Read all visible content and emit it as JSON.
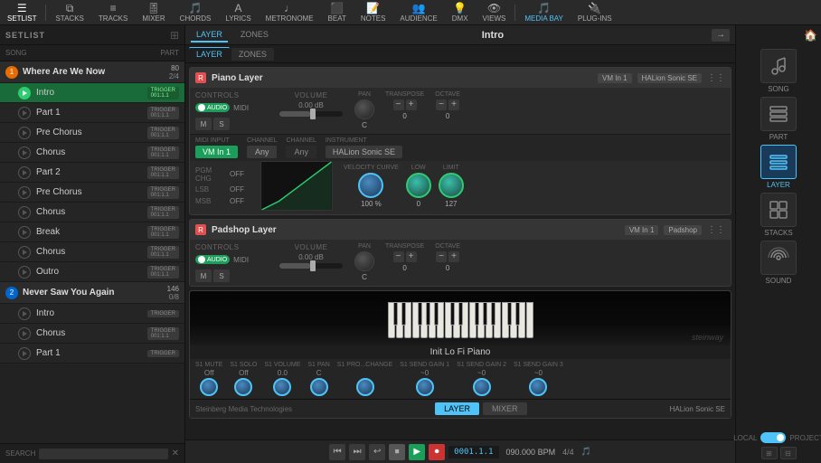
{
  "topNav": {
    "items": [
      {
        "label": "SETLIST",
        "icon": "☰",
        "active": false
      },
      {
        "label": "STACKS",
        "icon": "⧉",
        "active": false
      },
      {
        "label": "TRACKS",
        "icon": "≡",
        "active": false
      },
      {
        "label": "MIXER",
        "icon": "🎚",
        "active": false
      },
      {
        "label": "CHORDS",
        "icon": "🎵",
        "active": false
      },
      {
        "label": "LYRICS",
        "icon": "A",
        "active": false
      },
      {
        "label": "METRONOME",
        "icon": "♩",
        "active": false
      },
      {
        "label": "BEAT",
        "icon": "⬛",
        "active": false
      },
      {
        "label": "NOTES",
        "icon": "📝",
        "active": false
      },
      {
        "label": "AUDIENCE",
        "icon": "👥",
        "active": false
      },
      {
        "label": "DMX",
        "icon": "💡",
        "active": false
      },
      {
        "label": "VIEWS",
        "icon": "👁",
        "active": false
      },
      {
        "label": "MEDIA BAY",
        "icon": "🎵",
        "active": true
      },
      {
        "label": "PLUG-INS",
        "icon": "🔌",
        "active": false
      }
    ]
  },
  "setlist": {
    "title": "SETLIST",
    "subheader": {
      "song": "SONG",
      "part": "PART"
    },
    "songs": [
      {
        "number": "1",
        "name": "Where Are We Now",
        "meta1": "80",
        "meta2": "2/4",
        "color": "orange",
        "parts": [
          {
            "name": "Intro",
            "badge": "TRIGGER\n001:1.1",
            "active": true
          },
          {
            "name": "Part 1",
            "badge": "TRIGGER\n001:1.1",
            "active": false
          },
          {
            "name": "Pre Chorus",
            "badge": "TRIGGER\n001:1.1",
            "active": false
          },
          {
            "name": "Chorus",
            "badge": "TRIGGER\n001:1.1",
            "active": false
          },
          {
            "name": "Part 2",
            "badge": "TRIGGER\n001:1.1",
            "active": false
          },
          {
            "name": "Pre Chorus",
            "badge": "TRIGGER\n001:1.1",
            "active": false
          },
          {
            "name": "Chorus",
            "badge": "TRIGGER\n001:1.1",
            "active": false
          },
          {
            "name": "Break",
            "badge": "TRIGGER\n001:1.1",
            "active": false
          },
          {
            "name": "Chorus",
            "badge": "TRIGGER\n001:1.1",
            "active": false
          },
          {
            "name": "Outro",
            "badge": "TRIGGER\n001:1.1",
            "active": false
          }
        ]
      },
      {
        "number": "2",
        "name": "Never Saw You Again",
        "meta1": "146",
        "meta2": "0/8",
        "color": "blue",
        "parts": [
          {
            "name": "Intro",
            "badge": "TRIGGER",
            "active": false
          },
          {
            "name": "Chorus",
            "badge": "TRIGGER\n001:1.1",
            "active": false
          },
          {
            "name": "Part 1",
            "badge": "TRIGGER",
            "active": false
          }
        ]
      }
    ],
    "searchLabel": "SEARCH"
  },
  "centerPanel": {
    "tabs": [
      {
        "label": "LAYER",
        "active": true
      },
      {
        "label": "ZONES",
        "active": false
      }
    ],
    "songTitle": "Intro",
    "layerTabs": [
      {
        "label": "LAYER",
        "active": true
      },
      {
        "label": "ZONES",
        "active": false
      }
    ],
    "instruments": [
      {
        "name": "Piano Layer",
        "vm": "VM In 1",
        "plugin": "HALion Sonic SE",
        "controls": {
          "audio": "AUDIO",
          "midi": "MIDI",
          "mute": "M",
          "solo": "S"
        },
        "volume": "0.00 dB",
        "pan": "C",
        "transpose": "0",
        "octave": "0",
        "midiInput": "VM In 1",
        "channel": "Any",
        "channel2": "Any",
        "instrument": "HALion Sonic SE",
        "pgmChange": "OFF",
        "lsb": "OFF",
        "msb": "OFF",
        "velocity": "100 %",
        "low": "0",
        "limit": "127"
      },
      {
        "name": "Padshop Layer",
        "vm": "VM In 1",
        "plugin": "Padshop",
        "controls": {
          "audio": "AUDIO",
          "midi": "MIDI",
          "mute": "M",
          "solo": "S"
        },
        "volume": "0.00 dB",
        "pan": "C",
        "transpose": "0",
        "octave": "0"
      }
    ],
    "halion": {
      "name": "Init Lo Fi Piano",
      "brand": "Steinberg Media Technologies",
      "plugin": "HALion Sonic SE",
      "controls": [
        {
          "label": "S1 Mute",
          "val": "Off"
        },
        {
          "label": "S1 Solo",
          "val": "Off"
        },
        {
          "label": "S1 Volume",
          "val": "0.0"
        },
        {
          "label": "S1 Pan",
          "val": "C"
        },
        {
          "label": "S1 Pro...Change",
          "val": ""
        },
        {
          "label": "S1 Send Gain 1",
          "val": "~0"
        },
        {
          "label": "S1 Send Gain 2",
          "val": "~0"
        },
        {
          "label": "S1 Send Gain 3",
          "val": "~0"
        }
      ],
      "tabs": [
        {
          "label": "LAYER",
          "active": true
        },
        {
          "label": "MIXER",
          "active": false
        }
      ]
    }
  },
  "rightSidebar": {
    "topTabs": [
      {
        "label": "MEDIA BAY",
        "active": true
      },
      {
        "label": "PLUG-INS",
        "active": false
      }
    ],
    "items": [
      {
        "label": "SONG",
        "icon": "♩",
        "active": false
      },
      {
        "label": "PART",
        "icon": "⧉",
        "active": false
      },
      {
        "label": "LAYER",
        "icon": "≡",
        "active": true
      },
      {
        "label": "STACKS",
        "icon": "🗂",
        "active": false
      },
      {
        "label": "SOUND",
        "icon": "((•))",
        "active": false
      }
    ],
    "localLabel": "LOCAL",
    "projectLabel": "PROJECT"
  },
  "transport": {
    "position": "0001.1.1",
    "bpm": "090.000 BPM",
    "timeSignature": "4/4",
    "buttons": [
      "⏮",
      "⏭",
      "↩",
      "⏹",
      "▶",
      "⏺"
    ]
  }
}
